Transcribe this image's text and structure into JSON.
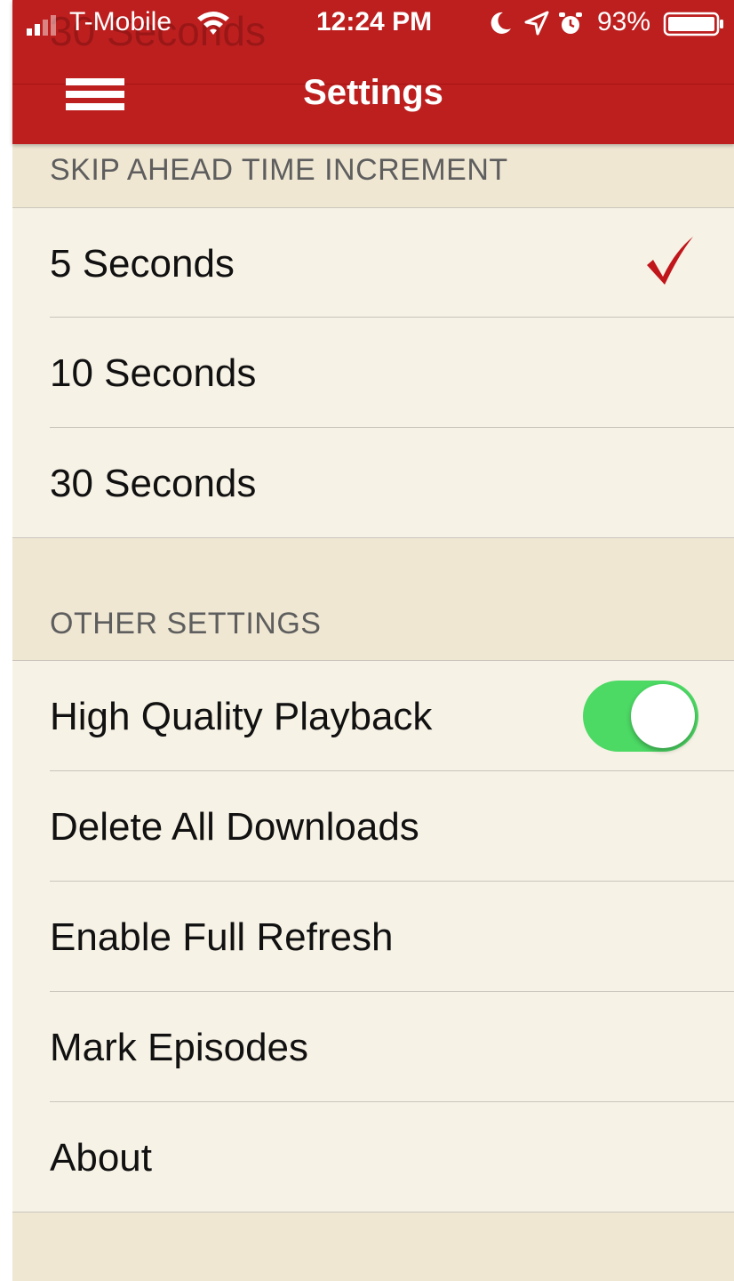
{
  "status_bar": {
    "carrier": "T-Mobile",
    "time": "12:24 PM",
    "battery": "93%",
    "icons": [
      "signal-icon",
      "wifi-icon",
      "moon-icon",
      "location-icon",
      "alarm-icon",
      "battery-icon"
    ]
  },
  "navbar": {
    "title": "Settings",
    "menu_icon": "hamburger-menu-icon",
    "ghost_text": "30 Seconds",
    "color": "#bd1f1f"
  },
  "skip_section": {
    "header": "SKIP AHEAD TIME INCREMENT",
    "options": [
      {
        "label": "5 Seconds",
        "selected": true
      },
      {
        "label": "10 Seconds",
        "selected": false
      },
      {
        "label": "30 Seconds",
        "selected": false
      }
    ],
    "check_color": "#c0161b"
  },
  "other_section": {
    "header": "OTHER SETTINGS",
    "items": [
      {
        "label": "High Quality Playback",
        "toggle": true,
        "toggle_on": true
      },
      {
        "label": "Delete All Downloads"
      },
      {
        "label": "Enable Full Refresh"
      },
      {
        "label": "Mark Episodes"
      },
      {
        "label": "About"
      }
    ],
    "toggle_color": "#4cd964"
  }
}
